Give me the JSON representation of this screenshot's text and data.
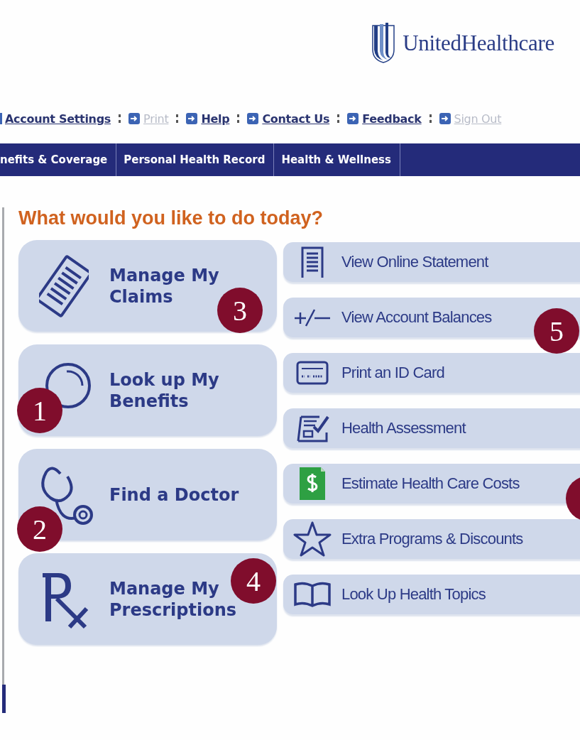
{
  "brand": {
    "name": "UnitedHealthcare"
  },
  "utility_links": [
    {
      "label": "Account Settings",
      "disabled": false
    },
    {
      "label": "Print",
      "disabled": true
    },
    {
      "label": "Help",
      "disabled": false
    },
    {
      "label": "Contact Us",
      "disabled": false
    },
    {
      "label": "Feedback",
      "disabled": false
    },
    {
      "label": "Sign Out",
      "disabled": true
    }
  ],
  "nav": [
    {
      "label": "nefits & Coverage"
    },
    {
      "label": "Personal Health Record"
    },
    {
      "label": "Health & Wellness"
    }
  ],
  "heading": "What would you like to do today?",
  "main_tasks": [
    {
      "kind": "claims",
      "label": "Manage My Claims"
    },
    {
      "kind": "benefits",
      "label": "Look up My Benefits"
    },
    {
      "kind": "doctor",
      "label": "Find a Doctor"
    },
    {
      "kind": "rx",
      "label": "Manage My Prescriptions"
    }
  ],
  "quick_links": [
    {
      "kind": "statement",
      "label": "View Online Statement"
    },
    {
      "kind": "balance",
      "label": "View Account Balances"
    },
    {
      "kind": "idcard",
      "label": "Print an ID Card"
    },
    {
      "kind": "assessment",
      "label": "Health Assessment"
    },
    {
      "kind": "costs",
      "label": "Estimate Health Care Costs"
    },
    {
      "kind": "star",
      "label": "Extra Programs & Discounts"
    },
    {
      "kind": "book",
      "label": "Look Up Health Topics"
    }
  ],
  "callouts": [
    {
      "kind": "numbered",
      "label": "3"
    },
    {
      "kind": "numbered",
      "label": "1"
    },
    {
      "kind": "numbered",
      "label": "2"
    },
    {
      "kind": "numbered",
      "label": "4"
    },
    {
      "kind": "numbered",
      "label": "5"
    },
    {
      "kind": "cut"
    }
  ]
}
